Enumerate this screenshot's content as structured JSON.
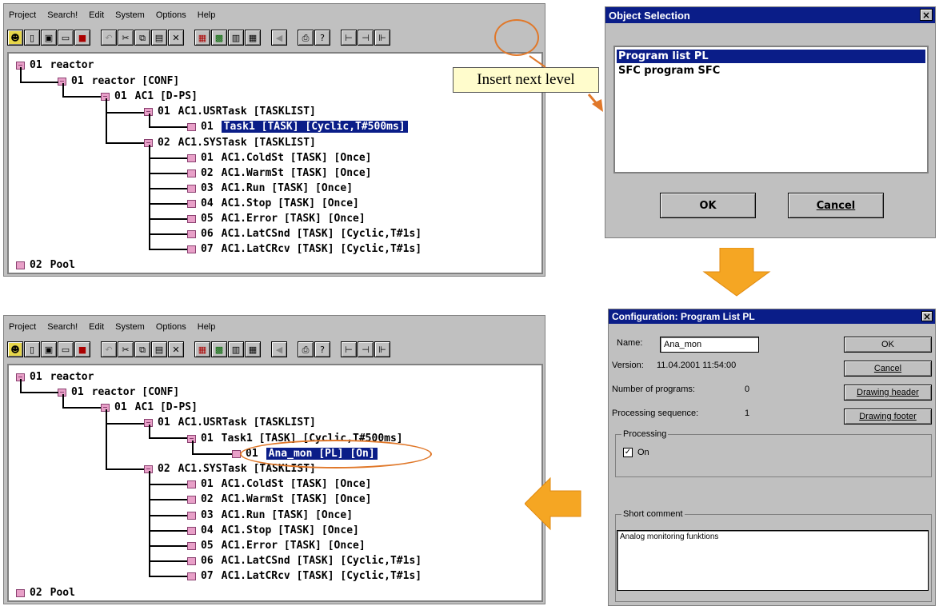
{
  "menu": [
    "Project",
    "Search!",
    "Edit",
    "System",
    "Options",
    "Help"
  ],
  "toolbar_icons": [
    "new-icon",
    "new-object-icon",
    "save-icon",
    "page-icon",
    "stop-icon",
    "undo-icon",
    "cut-icon",
    "copy-icon",
    "paste-icon",
    "delete-icon",
    "properties-icon",
    "edit-icon",
    "compare-icon",
    "table-icon",
    "back-icon",
    "print-icon",
    "help-icon",
    "insert-same-level-icon",
    "insert-sub-level-icon",
    "insert-next-level-icon"
  ],
  "tree_top": [
    {
      "num": "01",
      "text": "reactor"
    },
    {
      "num": "01",
      "text": "reactor  [CONF]"
    },
    {
      "num": "01",
      "text": "AC1  [D-PS]"
    },
    {
      "num": "01",
      "text": "AC1.USRTask  [TASKLIST]"
    },
    {
      "num": "01",
      "text": "Task1  [TASK] [Cyclic,T#500ms]"
    },
    {
      "num": "02",
      "text": "AC1.SYSTask  [TASKLIST]"
    },
    {
      "num": "01",
      "text": "AC1.ColdSt  [TASK] [Once]"
    },
    {
      "num": "02",
      "text": "AC1.WarmSt  [TASK] [Once]"
    },
    {
      "num": "03",
      "text": "AC1.Run  [TASK] [Once]"
    },
    {
      "num": "04",
      "text": "AC1.Stop  [TASK] [Once]"
    },
    {
      "num": "05",
      "text": "AC1.Error  [TASK] [Once]"
    },
    {
      "num": "06",
      "text": "AC1.LatCSnd  [TASK] [Cyclic,T#1s]"
    },
    {
      "num": "07",
      "text": "AC1.LatCRcv  [TASK] [Cyclic,T#1s]"
    },
    {
      "num": "02",
      "text": "Pool"
    }
  ],
  "tree_bottom": [
    {
      "num": "01",
      "text": "reactor"
    },
    {
      "num": "01",
      "text": "reactor  [CONF]"
    },
    {
      "num": "01",
      "text": "AC1  [D-PS]"
    },
    {
      "num": "01",
      "text": "AC1.USRTask  [TASKLIST]"
    },
    {
      "num": "01",
      "text": "Task1  [TASK] [Cyclic,T#500ms]"
    },
    {
      "num": "01",
      "text": "Ana_mon  [PL] [On]"
    },
    {
      "num": "02",
      "text": "AC1.SYSTask  [TASKLIST]"
    },
    {
      "num": "01",
      "text": "AC1.ColdSt  [TASK] [Once]"
    },
    {
      "num": "02",
      "text": "AC1.WarmSt  [TASK] [Once]"
    },
    {
      "num": "03",
      "text": "AC1.Run  [TASK] [Once]"
    },
    {
      "num": "04",
      "text": "AC1.Stop  [TASK] [Once]"
    },
    {
      "num": "05",
      "text": "AC1.Error  [TASK] [Once]"
    },
    {
      "num": "06",
      "text": "AC1.LatCSnd  [TASK] [Cyclic,T#1s]"
    },
    {
      "num": "07",
      "text": "AC1.LatCRcv  [TASK] [Cyclic,T#1s]"
    },
    {
      "num": "02",
      "text": "Pool"
    }
  ],
  "callout": {
    "text": "Insert next level"
  },
  "object_selection": {
    "title": "Object Selection",
    "close": "×",
    "items": [
      "Program list PL",
      "SFC program SFC"
    ],
    "ok": "OK",
    "cancel": "Cancel"
  },
  "config": {
    "title": "Configuration: Program List PL",
    "close": "×",
    "name_label": "Name:",
    "name_value": "Ana_mon",
    "version_label": "Version:",
    "version_value": "11.04.2001 11:54:00",
    "num_programs_label": "Number of programs:",
    "num_programs_value": "0",
    "proc_seq_label": "Processing sequence:",
    "proc_seq_value": "1",
    "processing_group": "Processing",
    "on_label": "On",
    "on_checked": true,
    "short_comment_group": "Short comment",
    "short_comment": "Analog monitoring funktions",
    "buttons": [
      "OK",
      "Cancel",
      "Drawing header",
      "Drawing footer"
    ]
  },
  "colors": {
    "highlight": "#0a1d88",
    "callout_bg": "#fffccc",
    "arrow": "#f5a623",
    "annotation_ring": "#e0782a"
  }
}
